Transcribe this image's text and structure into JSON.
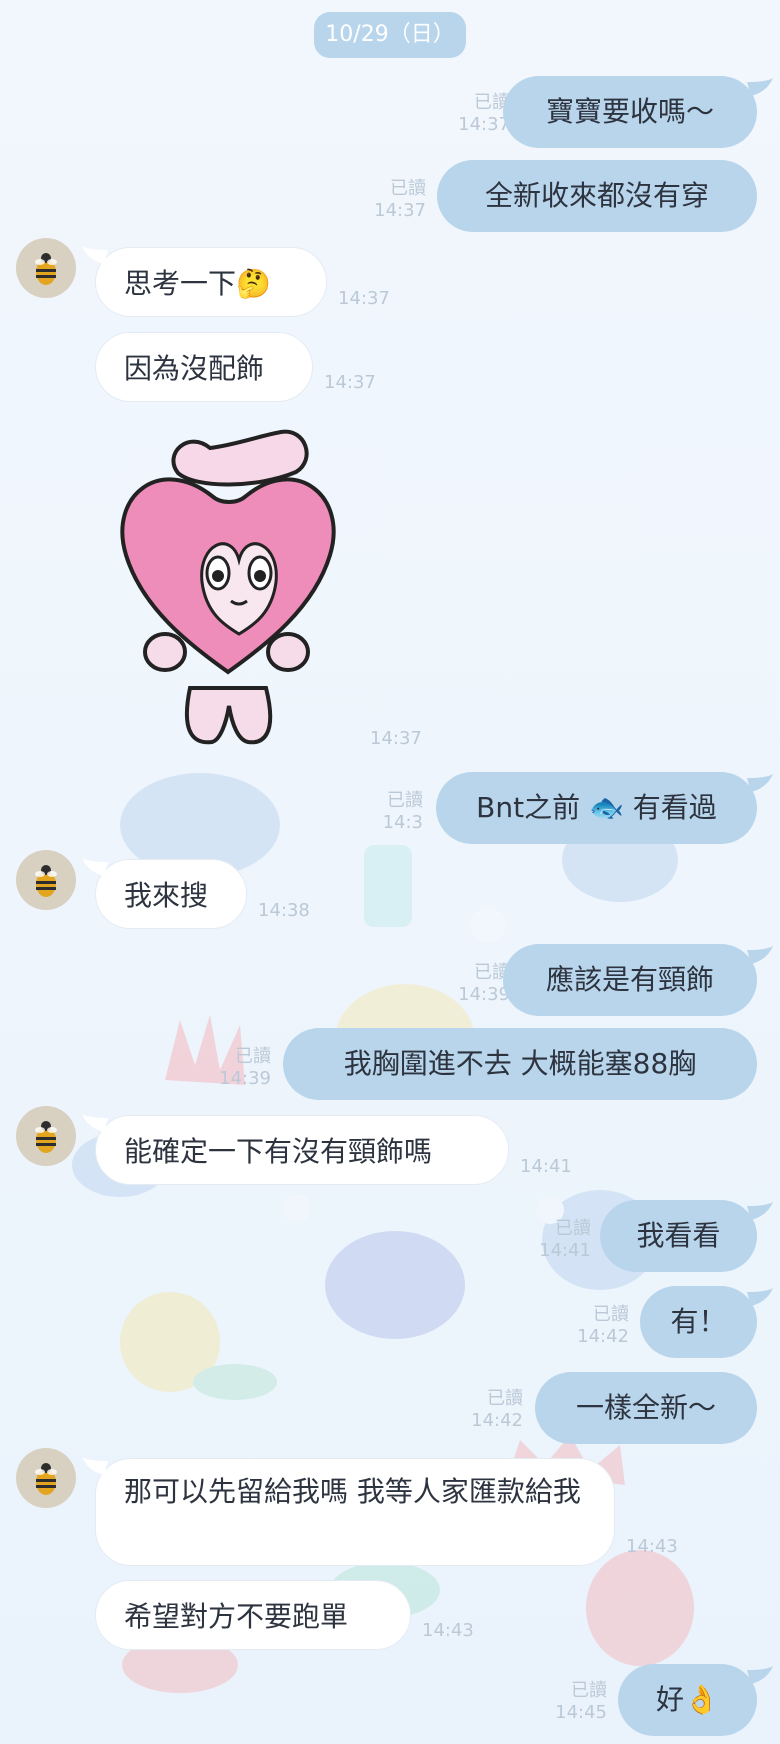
{
  "date": "10/29（日）",
  "read_label": "已讀",
  "messages": [
    {
      "text": "寶寶要收嗎～",
      "time": "14:37"
    },
    {
      "text": "全新收來都沒有穿",
      "time": "14:37"
    },
    {
      "text": "思考一下",
      "emoji": "🤔",
      "time": "14:37"
    },
    {
      "text": "因為沒配飾",
      "time": "14:37"
    },
    {
      "time": "14:37"
    },
    {
      "text_before": "Bnt之前",
      "emoji": "🐟",
      "text_after": "有看過",
      "time": "14:3"
    },
    {
      "text": "我來搜",
      "time": "14:38"
    },
    {
      "text": "應該是有頸飾",
      "time": "14:39"
    },
    {
      "text": "我胸圍進不去 大概能塞88胸",
      "time": "14:39"
    },
    {
      "text": "能確定一下有沒有頸飾嗎",
      "time": "14:41"
    },
    {
      "text": "我看看",
      "time": "14:41"
    },
    {
      "text": "有！",
      "time": "14:42"
    },
    {
      "text": "一樣全新～",
      "time": "14:42"
    },
    {
      "text": "那可以先留給我嗎 我等人家匯款給我",
      "time": "14:43"
    },
    {
      "text": "希望對方不要跑單",
      "time": "14:43"
    },
    {
      "text": "好",
      "emoji": "👌",
      "time": "14:45"
    }
  ],
  "icons": {
    "avatar": "bee-icon",
    "sticker": "pink-heart-bunny-icon",
    "thinking": "thinking-face-icon",
    "fish": "fish-icon",
    "ok": "ok-hand-icon"
  },
  "colors": {
    "background": "#edf4fb",
    "outgoing_bubble": "#b9d5eb",
    "incoming_bubble": "#ffffff",
    "date_pill": "#b9d5ec",
    "meta_text": "#bbc9d7",
    "message_text": "#2d3440"
  }
}
